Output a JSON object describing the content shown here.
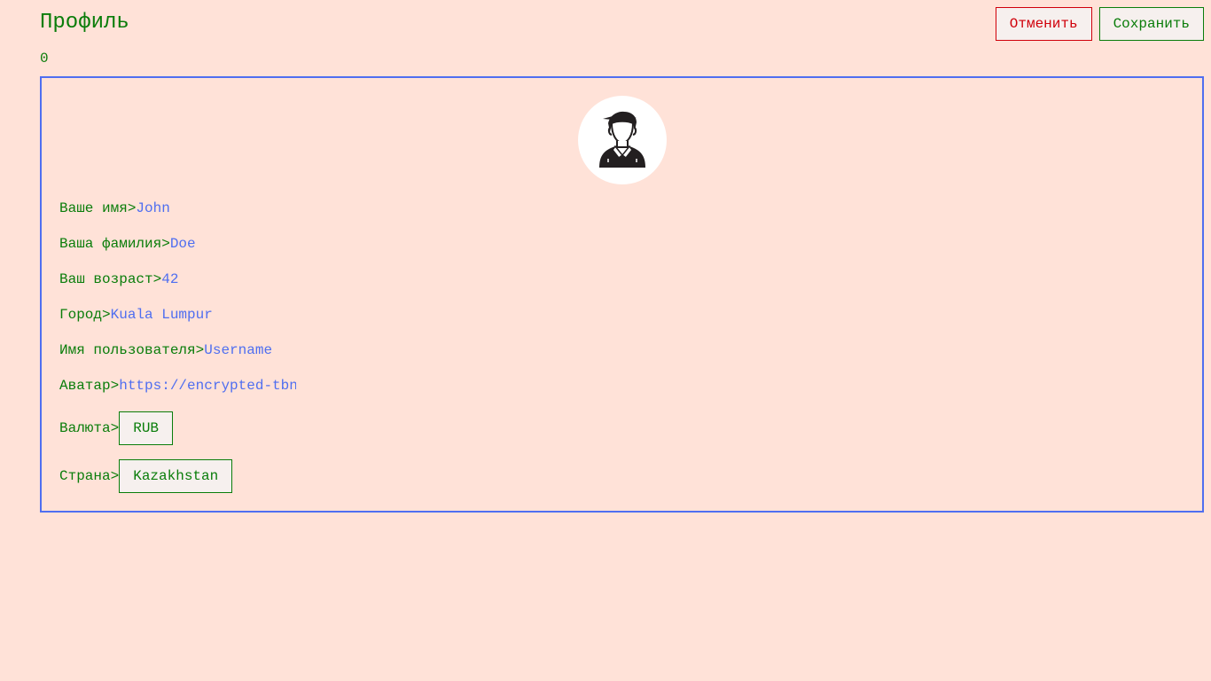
{
  "header": {
    "title": "Профиль",
    "cancel_label": "Отменить",
    "save_label": "Сохранить"
  },
  "counter": "0",
  "profile": {
    "avatar_icon": "user-avatar-icon",
    "fields": {
      "first_name": {
        "label": "Ваше имя>",
        "value": "John"
      },
      "last_name": {
        "label": "Ваша фамилия>",
        "value": "Doe"
      },
      "age": {
        "label": "Ваш возраст>",
        "value": "42"
      },
      "city": {
        "label": "Город>",
        "value": "Kuala Lumpur"
      },
      "username": {
        "label": "Имя пользователя>",
        "value": "Username"
      },
      "avatar_url": {
        "label": "Аватар>",
        "value": "https://encrypted-tbn"
      },
      "currency": {
        "label": "Валюта>",
        "value": "RUB"
      },
      "country": {
        "label": "Страна>",
        "value": "Kazakhstan"
      }
    }
  },
  "colors": {
    "background": "#ffe2d8",
    "primary_text": "#0a7d0a",
    "input_text": "#4f6ef0",
    "card_border": "#4f6ef0",
    "cancel": "#d0000a"
  }
}
